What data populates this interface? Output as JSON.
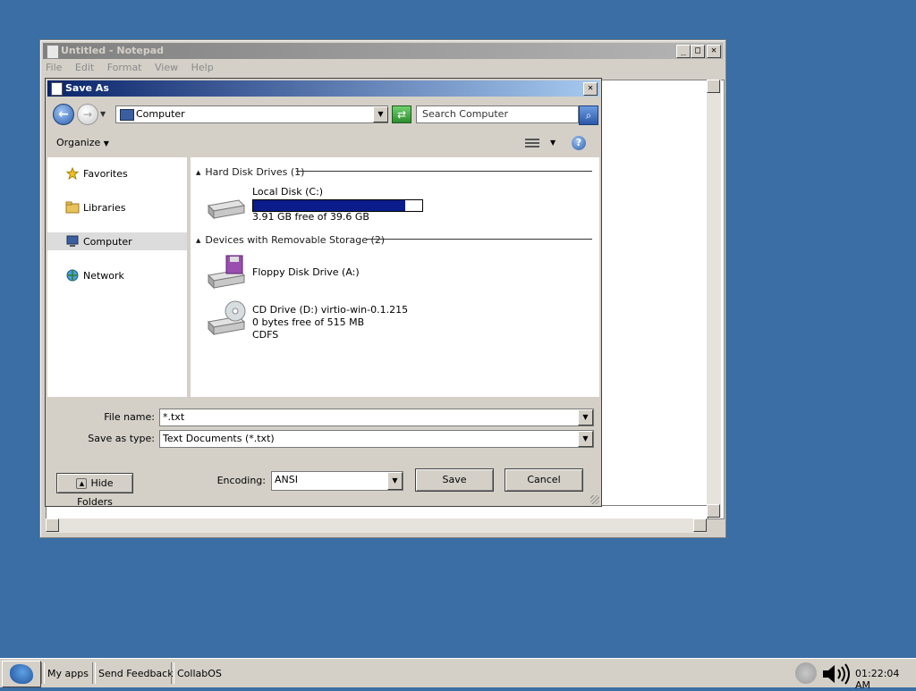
{
  "notepad": {
    "title": "Untitled - Notepad",
    "menu": [
      "File",
      "Edit",
      "Format",
      "View",
      "Help"
    ],
    "caption_buttons": {
      "minimize": "_",
      "maximize": "□",
      "close": "✕"
    }
  },
  "dialog": {
    "title": "Save As",
    "close_glyph": "✕",
    "address": "Computer",
    "search_placeholder": "Search Computer",
    "organize_label": "Organize",
    "help_glyph": "?",
    "nav_items": [
      {
        "label": "Favorites",
        "icon": "star-icon"
      },
      {
        "label": "Libraries",
        "icon": "folder-icon"
      },
      {
        "label": "Computer",
        "icon": "computer-icon",
        "selected": true
      },
      {
        "label": "Network",
        "icon": "network-icon"
      }
    ],
    "groups": {
      "hard_disks": "Hard Disk Drives (1)",
      "removable": "Devices with Removable Storage (2)"
    },
    "drives": {
      "local": {
        "name": "Local Disk (C:)",
        "free": "3.91 GB free of 39.6 GB",
        "used_fraction": 0.901
      },
      "floppy": {
        "name": "Floppy Disk Drive (A:)"
      },
      "cd": {
        "name": "CD Drive (D:) virtio-win-0.1.215",
        "free": "0 bytes free of 515 MB",
        "fs": "CDFS"
      }
    },
    "file_name_label": "File name:",
    "file_name_value": "*.txt",
    "save_type_label": "Save as type:",
    "save_type_value": "Text Documents (*.txt)",
    "hide_folders_label": "Hide Folders",
    "encoding_label": "Encoding:",
    "encoding_value": "ANSI",
    "save_label": "Save",
    "cancel_label": "Cancel"
  },
  "taskbar": {
    "items": [
      "My apps",
      "Send Feedback",
      "CollabOS"
    ],
    "clock": "01:22:04 AM"
  },
  "colors": {
    "desktop": "#3a6ea5",
    "dialog_title": "#0a246a",
    "usage_bar": "#0a1d8a"
  }
}
